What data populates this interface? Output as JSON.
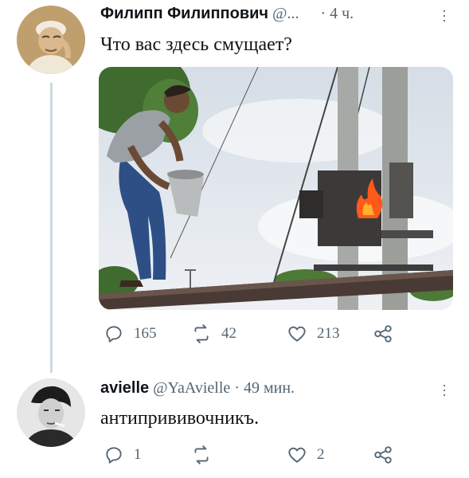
{
  "tweet1": {
    "name": "Филипп Филиппович",
    "handle": "@...",
    "time": "· 4 ч.",
    "text": "Что вас здесь смущает?",
    "replies": "165",
    "retweets": "42",
    "likes": "213"
  },
  "tweet2": {
    "name": "avielle",
    "handle": "@YaAvielle",
    "time": "· 49 мин.",
    "text": "антипрививочникъ.",
    "replies": "1",
    "retweets": "",
    "likes": "2"
  },
  "icons": {
    "reply": "reply-icon",
    "retweet": "retweet-icon",
    "like": "heart-icon",
    "share": "share-icon",
    "more": "more-icon"
  },
  "colors": {
    "secondary_text": "#536471",
    "thread_line": "#cfd9de",
    "fire": "#ff5a1a"
  }
}
